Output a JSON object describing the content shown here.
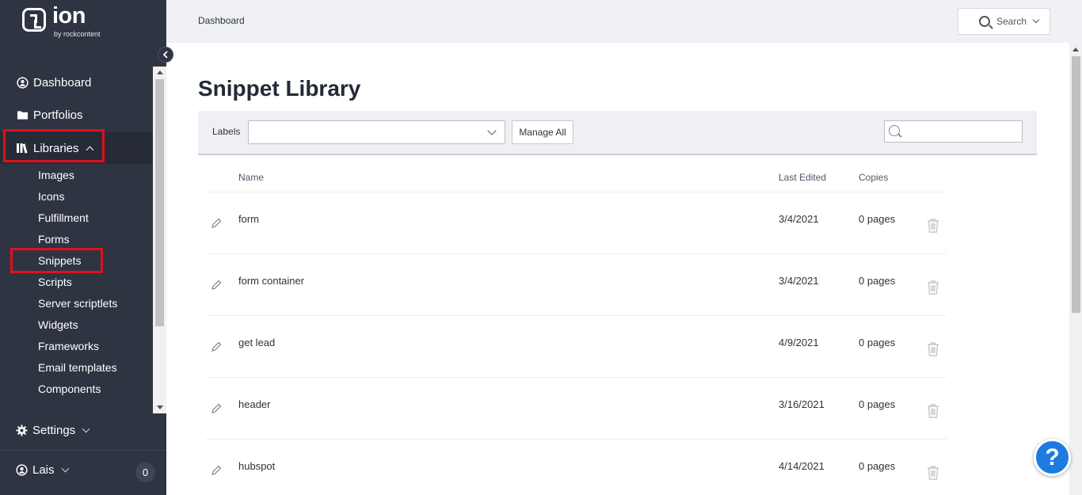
{
  "brand": {
    "name": "ion",
    "tagline": "by rockcontent"
  },
  "sidebar": {
    "items": [
      {
        "label": "Dashboard",
        "icon": "user-circle-icon"
      },
      {
        "label": "Portfolios",
        "icon": "folder-icon"
      },
      {
        "label": "Libraries",
        "icon": "books-icon"
      }
    ],
    "library_items": [
      "Images",
      "Icons",
      "Fulfillment",
      "Forms",
      "Snippets",
      "Scripts",
      "Server scriptlets",
      "Widgets",
      "Frameworks",
      "Email templates",
      "Components"
    ],
    "settings": "Settings",
    "user": {
      "name": "Lais",
      "badge": "0"
    }
  },
  "topbar": {
    "breadcrumb": "Dashboard",
    "search_label": "Search"
  },
  "page": {
    "title": "Snippet Library",
    "filter": {
      "labels_label": "Labels",
      "manage_all": "Manage All"
    },
    "table": {
      "columns": {
        "name": "Name",
        "last_edited": "Last Edited",
        "copies": "Copies"
      },
      "rows": [
        {
          "name": "form",
          "last_edited": "3/4/2021",
          "copies": "0 pages"
        },
        {
          "name": "form container",
          "last_edited": "3/4/2021",
          "copies": "0 pages"
        },
        {
          "name": "get lead",
          "last_edited": "4/9/2021",
          "copies": "0 pages"
        },
        {
          "name": "header",
          "last_edited": "3/16/2021",
          "copies": "0 pages"
        },
        {
          "name": "hubspot",
          "last_edited": "4/14/2021",
          "copies": "0 pages"
        }
      ]
    }
  },
  "help": {
    "label": "?"
  },
  "colors": {
    "sidebar_bg": "#2e3442",
    "highlight_red": "#e0111b",
    "help_blue": "#1c7be0"
  }
}
